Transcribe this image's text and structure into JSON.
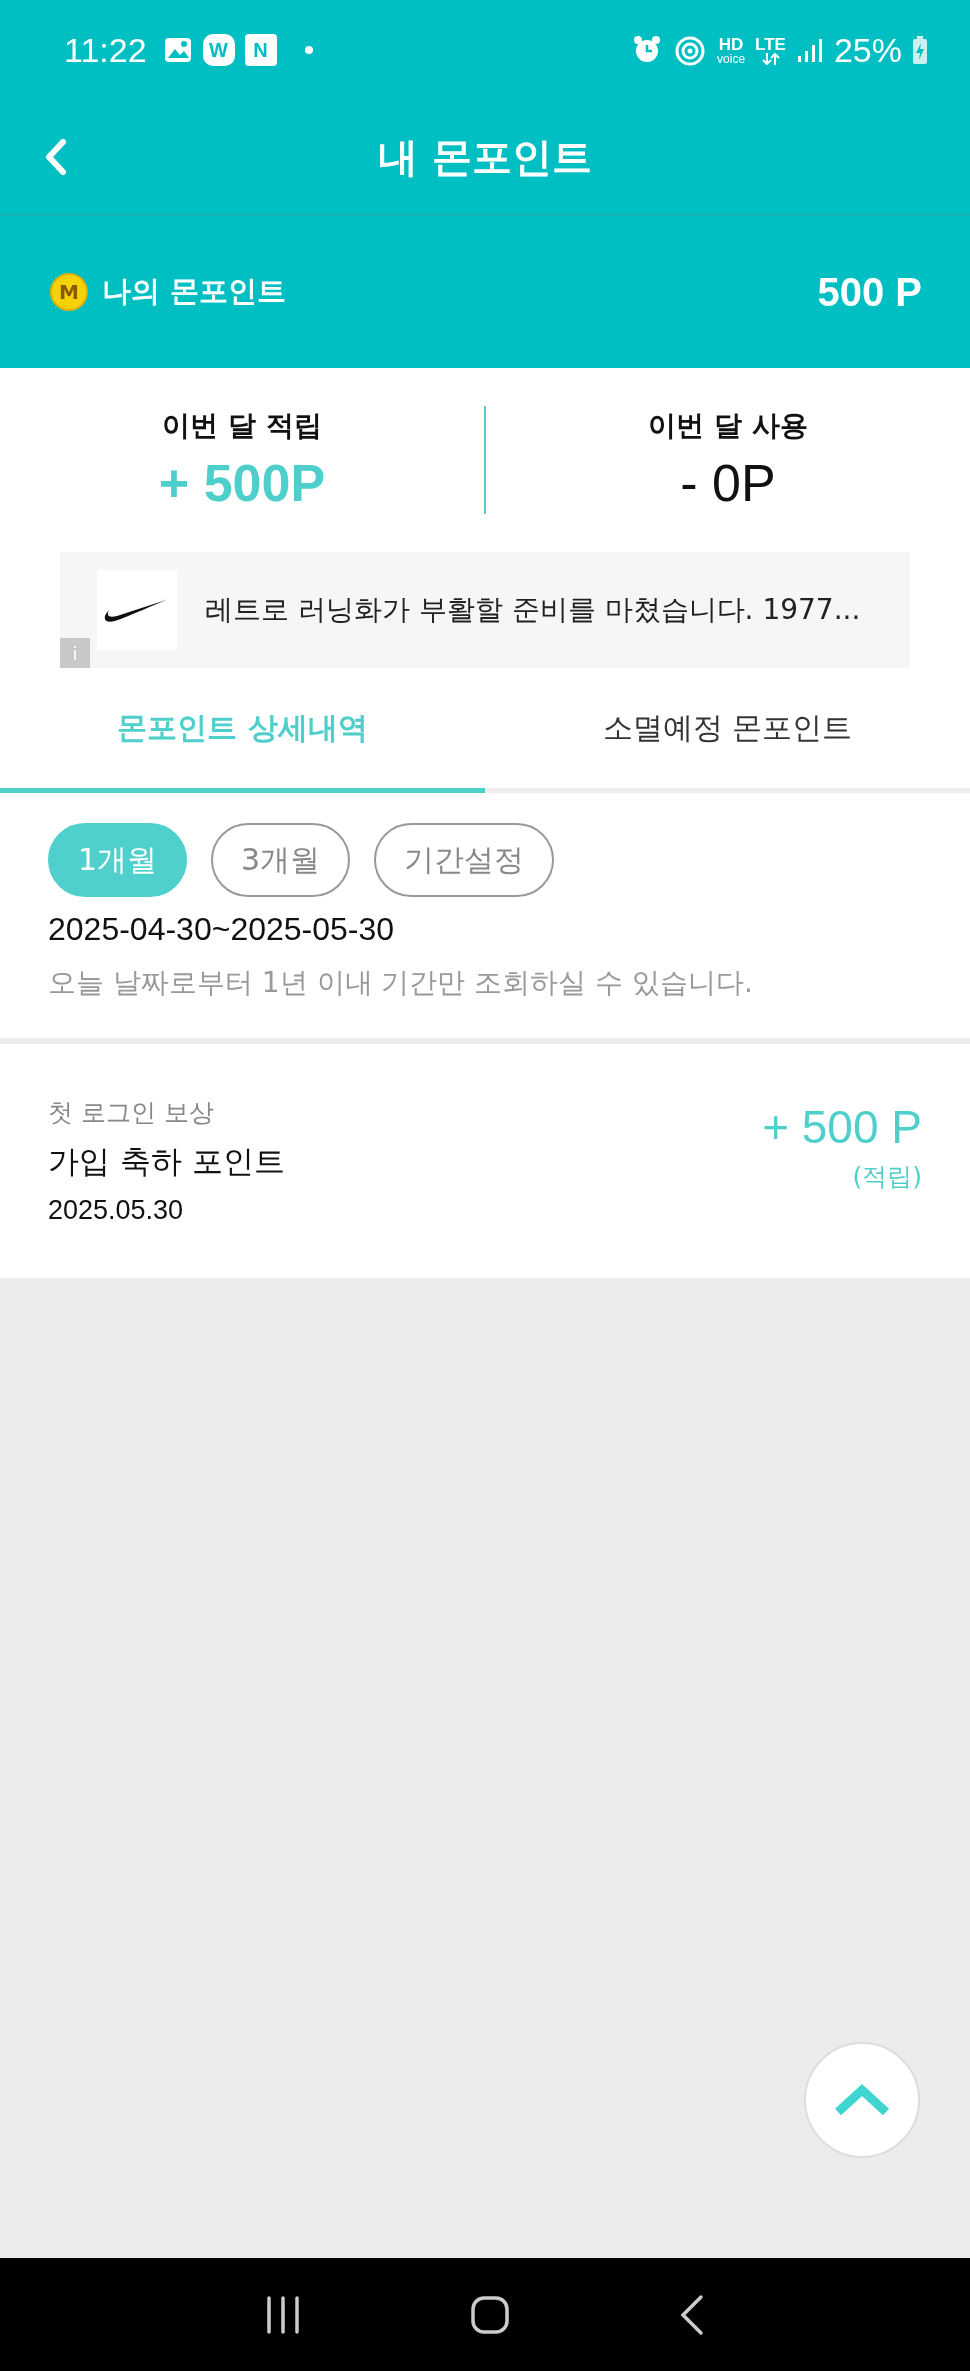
{
  "status_bar": {
    "time": "11:22",
    "notification_badges": [
      "W",
      "N"
    ],
    "hd": "HD",
    "voice": "voice",
    "lte": "LTE",
    "battery": "25%"
  },
  "header": {
    "title": "내 몬포인트"
  },
  "my_points": {
    "label": "나의 몬포인트",
    "coin": "M",
    "value": "500 P"
  },
  "summary": [
    {
      "label": "이번 달 적립",
      "value": "+ 500P",
      "kind": "earn"
    },
    {
      "label": "이번 달 사용",
      "value": "- 0P",
      "kind": "use"
    }
  ],
  "ad": {
    "text": "레트로 러닝화가 부활할 준비를 마쳤습니다. 1977...",
    "info": "i"
  },
  "tabs": [
    {
      "label": "몬포인트 상세내역",
      "selected": true
    },
    {
      "label": "소멸예정 몬포인트",
      "selected": false
    }
  ],
  "filters": [
    {
      "label": "1개월",
      "selected": true
    },
    {
      "label": "3개월",
      "selected": false
    },
    {
      "label": "기간설정",
      "selected": false
    }
  ],
  "period": "2025-04-30~2025-05-30",
  "notice": "오늘 날짜로부터 1년 이내 기간만 조회하실 수 있습니다.",
  "history": [
    {
      "category": "첫 로그인 보상",
      "title": "가입 축하 포인트",
      "date": "2025.05.30",
      "amount": "+ 500 P",
      "type": "(적립)"
    }
  ]
}
